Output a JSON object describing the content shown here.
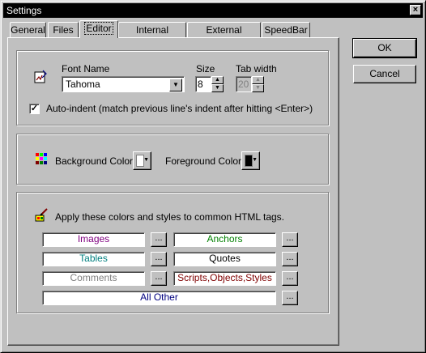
{
  "window": {
    "title": "Settings",
    "close_glyph": "×"
  },
  "tabs": [
    {
      "label": "General",
      "active": false
    },
    {
      "label": "Files",
      "active": false
    },
    {
      "label": "Editor",
      "active": true
    },
    {
      "label": "Internal Browser",
      "active": false
    },
    {
      "label": "External Browser",
      "active": false
    },
    {
      "label": "SpeedBar",
      "active": false
    }
  ],
  "buttons": {
    "ok": "OK",
    "cancel": "Cancel"
  },
  "editor": {
    "font_name_label": "Font Name",
    "font_name_value": "Tahoma",
    "size_label": "Size",
    "size_value": "8",
    "tab_width_label": "Tab width",
    "tab_width_value": "20",
    "auto_indent_label": "Auto-indent (match previous line's indent after hitting <Enter>)",
    "auto_indent_checked": true
  },
  "colors": {
    "background_label": "Background Color",
    "background_value": "#ffffff",
    "foreground_label": "Foreground Color",
    "foreground_value": "#000000"
  },
  "tags": {
    "intro": "Apply these colors and styles to common HTML tags.",
    "browse_label": "...",
    "items": [
      {
        "label": "Images",
        "color": "#800080"
      },
      {
        "label": "Anchors",
        "color": "#008000"
      },
      {
        "label": "Tables",
        "color": "#008080"
      },
      {
        "label": "Quotes",
        "color": "#000000"
      },
      {
        "label": "Comments",
        "color": "#808080"
      },
      {
        "label": "Scripts,Objects,Styles",
        "color": "#800000"
      },
      {
        "label": "All Other",
        "color": "#000080"
      }
    ]
  }
}
